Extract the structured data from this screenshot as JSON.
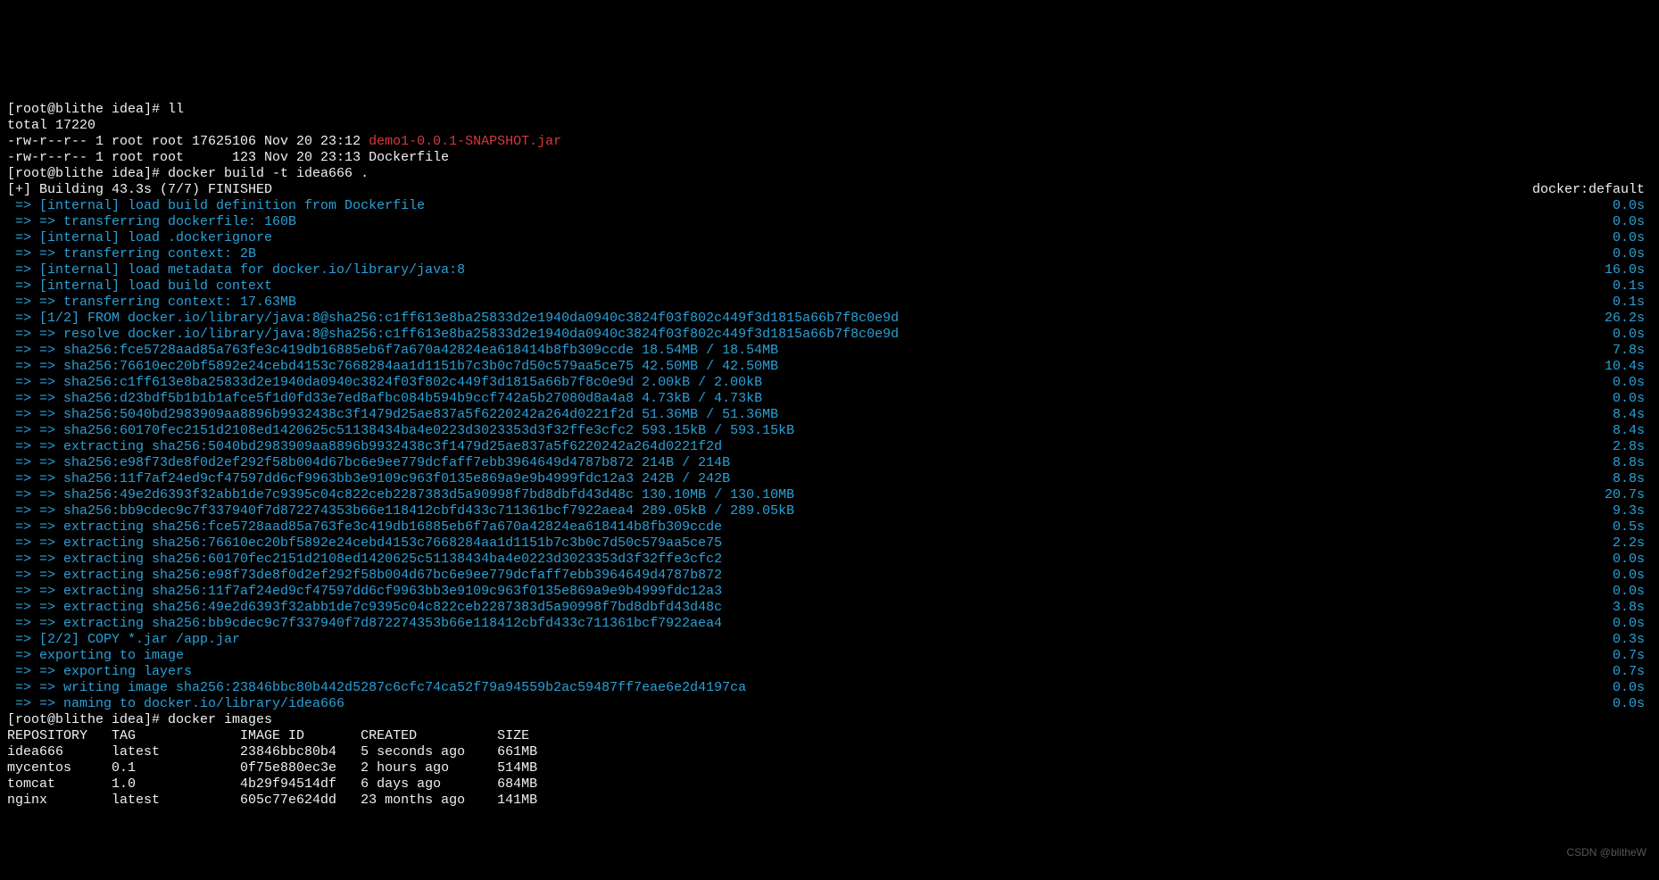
{
  "prompt1": "[root@blithe idea]# ll",
  "total": "total 17220",
  "ls1_pre": "-rw-r--r-- 1 root root 17625106 Nov 20 23:12 ",
  "ls1_file": "demo1-0.0.1-SNAPSHOT.jar",
  "ls2": "-rw-r--r-- 1 root root      123 Nov 20 23:13 Dockerfile",
  "prompt2": "[root@blithe idea]# docker build -t idea666 .",
  "build_hdr_left": "[+] Building 43.3s (7/7) FINISHED",
  "build_hdr_right": "docker:default",
  "steps": [
    {
      "l": "=> [internal] load build definition from Dockerfile",
      "r": "0.0s"
    },
    {
      "l": "=> => transferring dockerfile: 160B",
      "r": "0.0s"
    },
    {
      "l": "=> [internal] load .dockerignore",
      "r": "0.0s"
    },
    {
      "l": "=> => transferring context: 2B",
      "r": "0.0s"
    },
    {
      "l": "=> [internal] load metadata for docker.io/library/java:8",
      "r": "16.0s"
    },
    {
      "l": "=> [internal] load build context",
      "r": "0.1s"
    },
    {
      "l": "=> => transferring context: 17.63MB",
      "r": "0.1s"
    },
    {
      "l": "=> [1/2] FROM docker.io/library/java:8@sha256:c1ff613e8ba25833d2e1940da0940c3824f03f802c449f3d1815a66b7f8c0e9d",
      "r": "26.2s"
    },
    {
      "l": "=> => resolve docker.io/library/java:8@sha256:c1ff613e8ba25833d2e1940da0940c3824f03f802c449f3d1815a66b7f8c0e9d",
      "r": "0.0s"
    },
    {
      "l": "=> => sha256:fce5728aad85a763fe3c419db16885eb6f7a670a42824ea618414b8fb309ccde 18.54MB / 18.54MB",
      "r": "7.8s"
    },
    {
      "l": "=> => sha256:76610ec20bf5892e24cebd4153c7668284aa1d1151b7c3b0c7d50c579aa5ce75 42.50MB / 42.50MB",
      "r": "10.4s"
    },
    {
      "l": "=> => sha256:c1ff613e8ba25833d2e1940da0940c3824f03f802c449f3d1815a66b7f8c0e9d 2.00kB / 2.00kB",
      "r": "0.0s"
    },
    {
      "l": "=> => sha256:d23bdf5b1b1b1afce5f1d0fd33e7ed8afbc084b594b9ccf742a5b27080d8a4a8 4.73kB / 4.73kB",
      "r": "0.0s"
    },
    {
      "l": "=> => sha256:5040bd2983909aa8896b9932438c3f1479d25ae837a5f6220242a264d0221f2d 51.36MB / 51.36MB",
      "r": "8.4s"
    },
    {
      "l": "=> => sha256:60170fec2151d2108ed1420625c51138434ba4e0223d3023353d3f32ffe3cfc2 593.15kB / 593.15kB",
      "r": "8.4s"
    },
    {
      "l": "=> => extracting sha256:5040bd2983909aa8896b9932438c3f1479d25ae837a5f6220242a264d0221f2d",
      "r": "2.8s"
    },
    {
      "l": "=> => sha256:e98f73de8f0d2ef292f58b004d67bc6e9ee779dcfaff7ebb3964649d4787b872 214B / 214B",
      "r": "8.8s"
    },
    {
      "l": "=> => sha256:11f7af24ed9cf47597dd6cf9963bb3e9109c963f0135e869a9e9b4999fdc12a3 242B / 242B",
      "r": "8.8s"
    },
    {
      "l": "=> => sha256:49e2d6393f32abb1de7c9395c04c822ceb2287383d5a90998f7bd8dbfd43d48c 130.10MB / 130.10MB",
      "r": "20.7s"
    },
    {
      "l": "=> => sha256:bb9cdec9c7f337940f7d872274353b66e118412cbfd433c711361bcf7922aea4 289.05kB / 289.05kB",
      "r": "9.3s"
    },
    {
      "l": "=> => extracting sha256:fce5728aad85a763fe3c419db16885eb6f7a670a42824ea618414b8fb309ccde",
      "r": "0.5s"
    },
    {
      "l": "=> => extracting sha256:76610ec20bf5892e24cebd4153c7668284aa1d1151b7c3b0c7d50c579aa5ce75",
      "r": "2.2s"
    },
    {
      "l": "=> => extracting sha256:60170fec2151d2108ed1420625c51138434ba4e0223d3023353d3f32ffe3cfc2",
      "r": "0.0s"
    },
    {
      "l": "=> => extracting sha256:e98f73de8f0d2ef292f58b004d67bc6e9ee779dcfaff7ebb3964649d4787b872",
      "r": "0.0s"
    },
    {
      "l": "=> => extracting sha256:11f7af24ed9cf47597dd6cf9963bb3e9109c963f0135e869a9e9b4999fdc12a3",
      "r": "0.0s"
    },
    {
      "l": "=> => extracting sha256:49e2d6393f32abb1de7c9395c04c822ceb2287383d5a90998f7bd8dbfd43d48c",
      "r": "3.8s"
    },
    {
      "l": "=> => extracting sha256:bb9cdec9c7f337940f7d872274353b66e118412cbfd433c711361bcf7922aea4",
      "r": "0.0s"
    },
    {
      "l": "=> [2/2] COPY *.jar /app.jar",
      "r": "0.3s"
    },
    {
      "l": "=> exporting to image",
      "r": "0.7s"
    },
    {
      "l": "=> => exporting layers",
      "r": "0.7s"
    },
    {
      "l": "=> => writing image sha256:23846bbc80b442d5287c6cfc74ca52f79a94559b2ac59487ff7eae6e2d4197ca",
      "r": "0.0s"
    },
    {
      "l": "=> => naming to docker.io/library/idea666",
      "r": "0.0s"
    }
  ],
  "prompt3": "[root@blithe idea]# docker images",
  "images_header": "REPOSITORY   TAG             IMAGE ID       CREATED          SIZE",
  "images_rows": [
    "idea666      latest          23846bbc80b4   5 seconds ago    661MB",
    "mycentos     0.1             0f75e880ec3e   2 hours ago      514MB",
    "tomcat       1.0             4b29f94514df   6 days ago       684MB",
    "nginx        latest          605c77e624dd   23 months ago    141MB"
  ],
  "watermark": "CSDN @blitheW"
}
